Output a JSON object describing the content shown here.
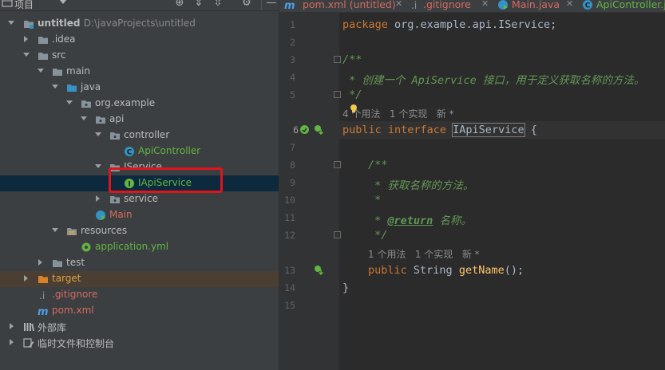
{
  "project_panel": {
    "title": "项目",
    "tree": [
      {
        "label": "untitled",
        "sublabel": "D:\\javaProjects\\untitled",
        "icon": "module-folder-icon",
        "expanded": true
      },
      {
        "label": ".idea",
        "icon": "folder-icon",
        "expanded": false
      },
      {
        "label": "src",
        "icon": "folder-icon",
        "expanded": true
      },
      {
        "label": "main",
        "icon": "folder-icon",
        "expanded": true
      },
      {
        "label": "java",
        "icon": "source-folder-icon",
        "expanded": true
      },
      {
        "label": "org.example",
        "icon": "package-icon",
        "expanded": true
      },
      {
        "label": "api",
        "icon": "package-icon",
        "expanded": true
      },
      {
        "label": "controller",
        "icon": "package-icon",
        "expanded": true
      },
      {
        "label": "ApiController",
        "icon": "class-icon"
      },
      {
        "label": "IService",
        "icon": "package-icon",
        "expanded": true
      },
      {
        "label": "IApiService",
        "icon": "interface-icon",
        "selected": true
      },
      {
        "label": "service",
        "icon": "package-icon",
        "expanded": false
      },
      {
        "label": "Main",
        "icon": "main-class-icon"
      },
      {
        "label": "resources",
        "icon": "resources-folder-icon",
        "expanded": true
      },
      {
        "label": "application.yml",
        "icon": "yaml-icon"
      },
      {
        "label": "test",
        "icon": "folder-icon",
        "expanded": false
      },
      {
        "label": "target",
        "icon": "excluded-folder-icon",
        "expanded": false
      },
      {
        "label": ".gitignore",
        "icon": "gitignore-icon"
      },
      {
        "label": "pom.xml",
        "icon": "maven-icon"
      },
      {
        "label": "外部库",
        "icon": "library-icon",
        "expanded": false
      },
      {
        "label": "临时文件和控制台",
        "icon": "scratch-icon",
        "expanded": false
      }
    ]
  },
  "tabs": [
    {
      "label": "pom.xml (untitled)",
      "icon": "maven-icon",
      "color": "#d46a5f"
    },
    {
      "label": ".gitignore",
      "icon": "gitignore-icon",
      "color": "#d46a5f"
    },
    {
      "label": "Main.java",
      "icon": "main-class-icon",
      "color": "#d46a5f"
    },
    {
      "label": "ApiController.ja",
      "icon": "class-icon",
      "color": "#62b543"
    }
  ],
  "editor": {
    "line_numbers": [
      "1",
      "2",
      "3",
      "4",
      "5",
      "6",
      "7",
      "8",
      "9",
      "10",
      "11",
      "12",
      "13",
      "14",
      "15"
    ],
    "current_line": "6",
    "code": {
      "l1_kw": "package",
      "l1_rest": " org.example.api.IService;",
      "l3": "/**",
      "l4": " * 创建一个 ApiService 接口，用于定义获取名称的方法。",
      "l5": " */",
      "l6_kw": "public interface ",
      "l6_name": "IApiService",
      "l6_rest": " {",
      "l8": "/**",
      "l9": " * 获取名称的方法。",
      "l10": " *",
      "l11_pre": " * ",
      "l11_tag": "@return",
      "l11_post": " 名称。",
      "l12": " */",
      "l13_kw": "public ",
      "l13_type": "String ",
      "l13_fn": "getName",
      "l13_rest": "();",
      "l14": "}"
    },
    "hints": {
      "interface_usages": "4 个用法",
      "interface_impls": "1 个实现",
      "interface_new": "新 *",
      "method_usages": "1 个用法",
      "method_impls": "1 个实现",
      "method_new": "新 *"
    }
  },
  "colors": {
    "selection": "#0d293e",
    "highlight_box": "#e0141b",
    "keyword": "#cc7832",
    "doc_comment": "#629755",
    "method": "#ffc66d"
  }
}
